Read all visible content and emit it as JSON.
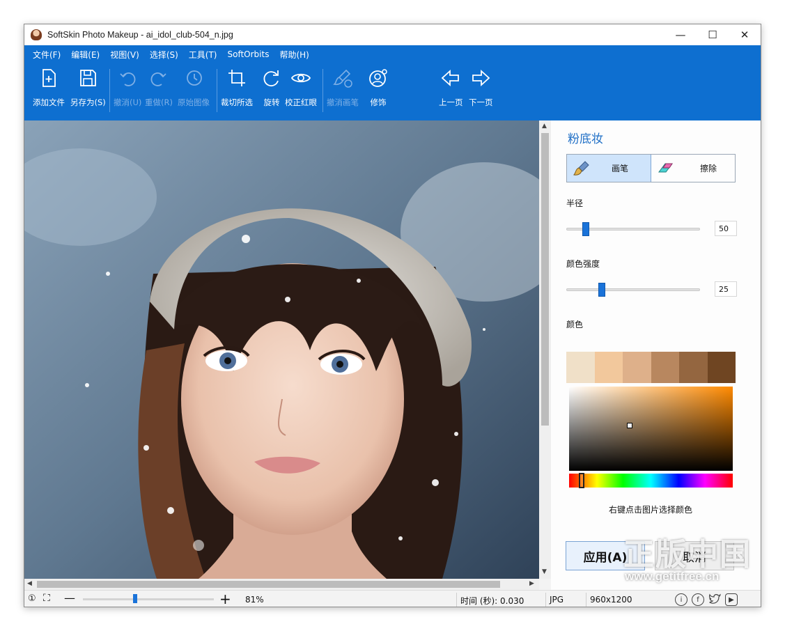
{
  "window": {
    "title": "SoftSkin Photo Makeup - ai_idol_club-504_n.jpg",
    "controls": {
      "minimize": "—",
      "maximize": "☐",
      "close": "✕"
    }
  },
  "menu": [
    "文件(F)",
    "编辑(E)",
    "视图(V)",
    "选择(S)",
    "工具(T)",
    "SoftOrbits",
    "帮助(H)"
  ],
  "toolbar": {
    "add_file": "添加文件",
    "save_as": "另存为(S)",
    "undo": "撤消(U)",
    "redo": "重做(R)",
    "original": "原始图像",
    "crop": "裁切所选",
    "rotate": "旋转",
    "red_eye": "校正红眼",
    "undo_brush": "撤消画笔",
    "retouch": "修饰",
    "prev_page": "上一页",
    "next_page": "下一页"
  },
  "panel": {
    "title": "粉底妆",
    "modes": {
      "brush": "画笔",
      "erase": "擦除",
      "active": "brush"
    },
    "radius": {
      "label": "半径",
      "value": "50",
      "level": 0.12
    },
    "intensity": {
      "label": "颜色强度",
      "value": "25",
      "level": 0.25
    },
    "color_label": "颜色",
    "swatches": [
      "#f0e0c8",
      "#f2c89c",
      "#deb08a",
      "#b8875f",
      "#946640",
      "#6f4522"
    ],
    "picker_base": "#ff8a00",
    "hint": "右键点击图片选择颜色",
    "apply": "应用(A)",
    "cancel": "取消"
  },
  "statusbar": {
    "zoom_percent": "81%",
    "time": "时间 (秒): 0.030",
    "format": "JPG",
    "dimensions": "960x1200"
  },
  "watermark": {
    "text": "正版中国",
    "url": "www.getitfree.cn"
  }
}
